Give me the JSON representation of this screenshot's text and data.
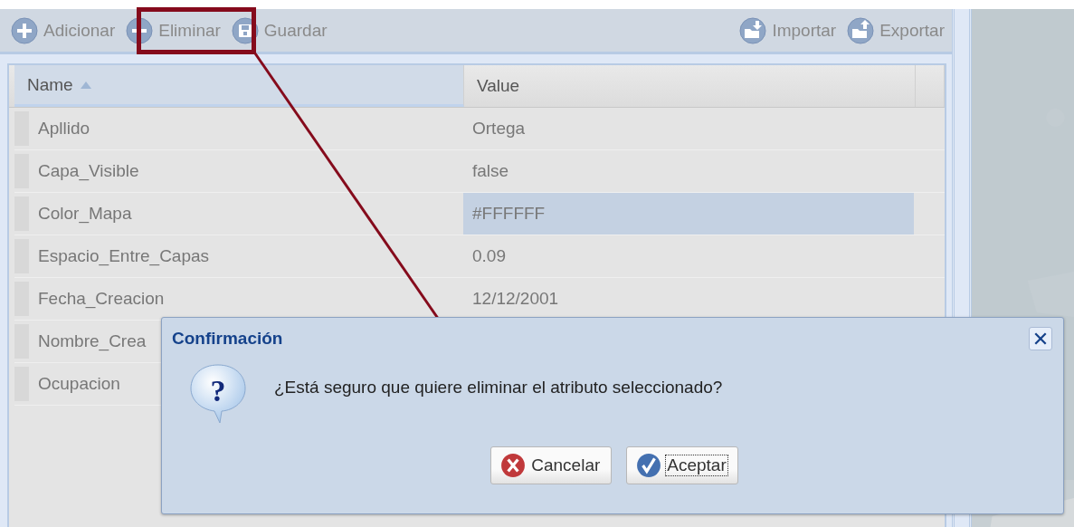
{
  "toolbar": {
    "left": [
      {
        "label": "Adicionar",
        "kind": "add"
      },
      {
        "label": "Eliminar",
        "kind": "remove"
      },
      {
        "label": "Guardar",
        "kind": "save"
      }
    ],
    "right": [
      {
        "label": "Importar",
        "kind": "import"
      },
      {
        "label": "Exportar",
        "kind": "export"
      }
    ]
  },
  "grid": {
    "columns": [
      {
        "label": "Name",
        "sorted": true
      },
      {
        "label": "Value",
        "sorted": false
      }
    ],
    "rows": [
      {
        "name": "Apllido",
        "value": "Ortega",
        "selected": false
      },
      {
        "name": "Capa_Visible",
        "value": "false",
        "selected": false
      },
      {
        "name": "Color_Mapa",
        "value": "#FFFFFF",
        "selected": true
      },
      {
        "name": "Espacio_Entre_Capas",
        "value": "0.09",
        "selected": false
      },
      {
        "name": "Fecha_Creacion",
        "value": "12/12/2001",
        "selected": false
      },
      {
        "name": "Nombre_Crea"
      },
      {
        "name": "Ocupacion"
      }
    ]
  },
  "dialog": {
    "title": "Confirmación",
    "icon_glyph": "?",
    "message": "¿Está seguro que quiere eliminar el atributo seleccionado?",
    "buttons": [
      {
        "label": "Cancelar",
        "kind": "cancel",
        "focused": false
      },
      {
        "label": "Aceptar",
        "kind": "ok",
        "focused": true
      }
    ]
  }
}
